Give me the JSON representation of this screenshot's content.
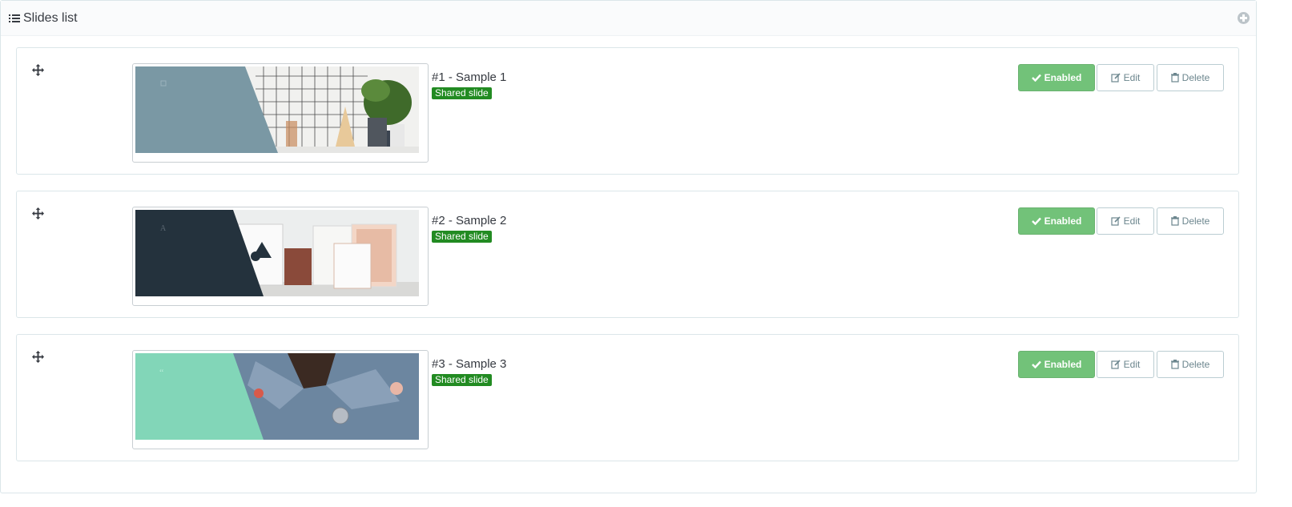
{
  "panel": {
    "title": "Slides list",
    "heading_icon": "list-icon",
    "add_icon": "plus-circle-icon"
  },
  "slides": [
    {
      "title": "#1 - Sample 1",
      "badge": "Shared slide",
      "enabled_label": "Enabled",
      "edit_label": "Edit",
      "delete_label": "Delete",
      "thumb_overlay_color": "#7a98a4"
    },
    {
      "title": "#2 - Sample 2",
      "badge": "Shared slide",
      "enabled_label": "Enabled",
      "edit_label": "Edit",
      "delete_label": "Delete",
      "thumb_overlay_color": "#24323d"
    },
    {
      "title": "#3 - Sample 3",
      "badge": "Shared slide",
      "enabled_label": "Enabled",
      "edit_label": "Edit",
      "delete_label": "Delete",
      "thumb_overlay_color": "#82d6b8"
    }
  ],
  "colors": {
    "enabled_bg": "#72c279",
    "badge_bg": "#228b22",
    "border": "#dbe6e9"
  }
}
